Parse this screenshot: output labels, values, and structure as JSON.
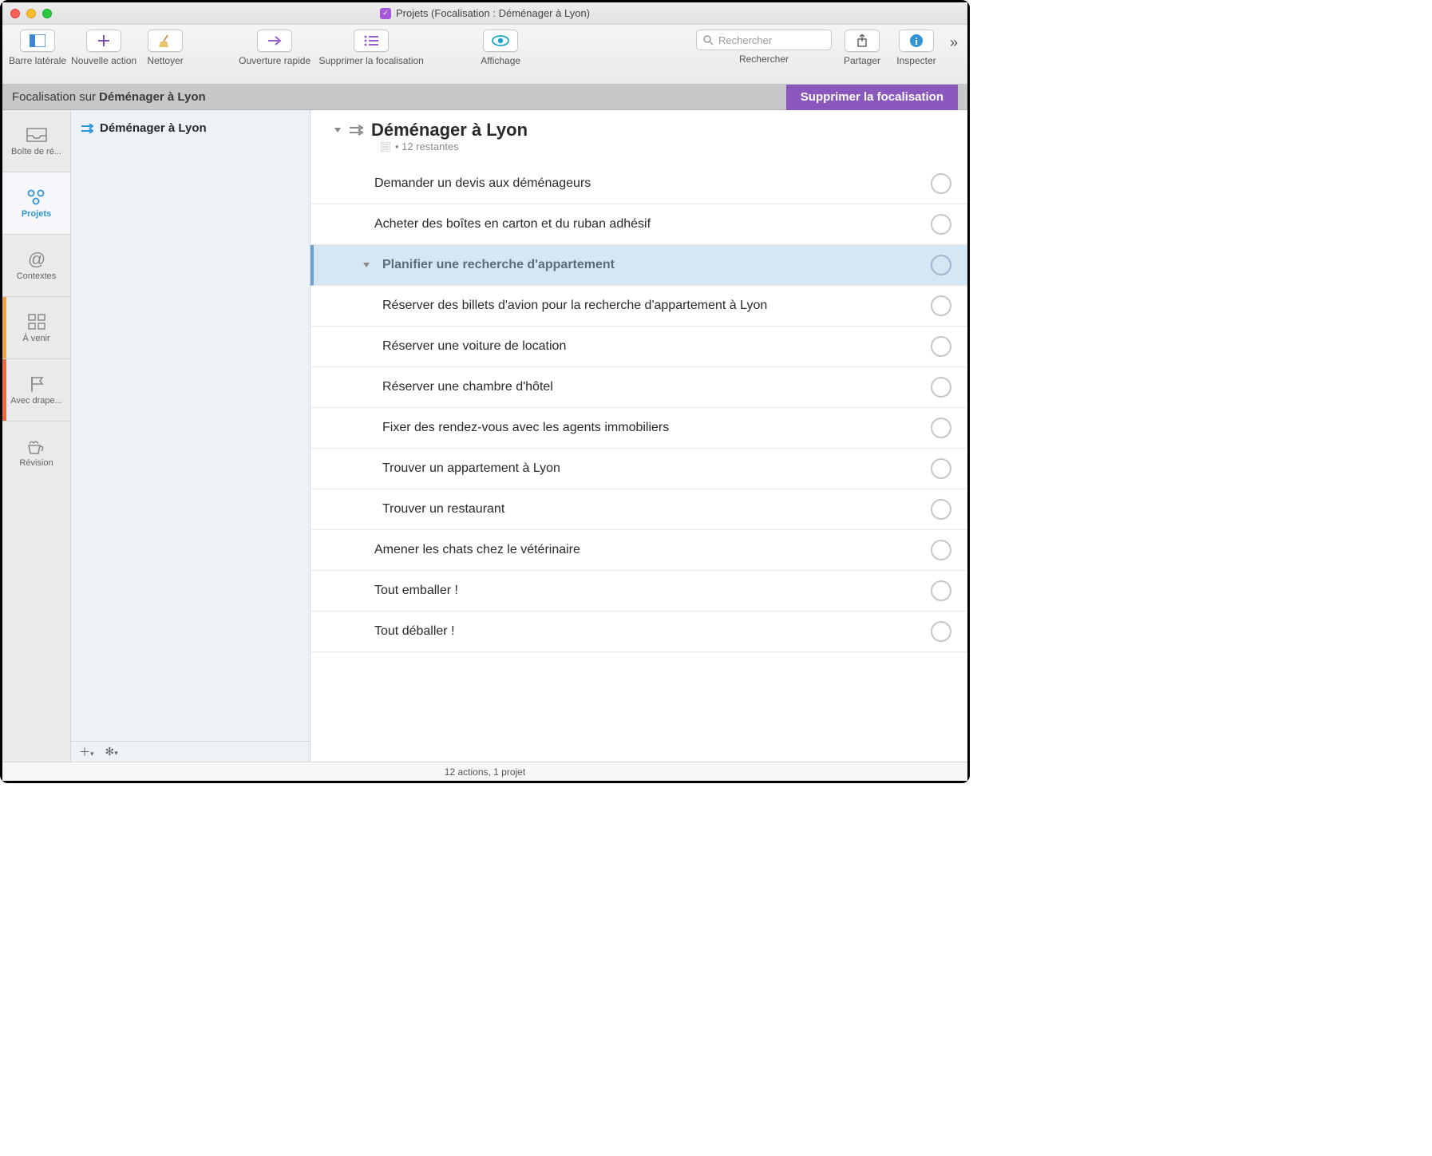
{
  "window": {
    "title": "Projets (Focalisation : Déménager à Lyon)"
  },
  "toolbar": {
    "sidebar": "Barre latérale",
    "new_action": "Nouvelle action",
    "cleanup": "Nettoyer",
    "quick_open": "Ouverture rapide",
    "remove_focus": "Supprimer la focalisation",
    "view": "Affichage",
    "search_placeholder": "Rechercher",
    "search_label": "Rechercher",
    "share": "Partager",
    "inspect": "Inspecter"
  },
  "focus": {
    "prefix": "Focalisation sur ",
    "project": "Déménager à Lyon",
    "remove": "Supprimer la focalisation"
  },
  "perspectives": [
    {
      "key": "inbox",
      "label": "Boîte de ré..."
    },
    {
      "key": "projects",
      "label": "Projets"
    },
    {
      "key": "contexts",
      "label": "Contextes"
    },
    {
      "key": "forecast",
      "label": "À venir"
    },
    {
      "key": "flagged",
      "label": "Avec drape..."
    },
    {
      "key": "review",
      "label": "Révision"
    }
  ],
  "project_list": {
    "items": [
      {
        "name": "Déménager à Lyon"
      }
    ]
  },
  "content": {
    "title": "Déménager à Lyon",
    "remaining": "12 restantes",
    "tasks": [
      {
        "title": "Demander un devis aux déménageurs",
        "indent": 0,
        "group": false
      },
      {
        "title": "Acheter des boîtes en carton et du ruban adhésif",
        "indent": 0,
        "group": false
      },
      {
        "title": "Planifier une recherche d'appartement",
        "indent": 0,
        "group": true,
        "selected": true
      },
      {
        "title": "Réserver des billets d'avion pour la recherche d'appartement à Lyon",
        "indent": 1,
        "group": false
      },
      {
        "title": "Réserver une voiture de location",
        "indent": 1,
        "group": false
      },
      {
        "title": "Réserver une chambre d'hôtel",
        "indent": 1,
        "group": false
      },
      {
        "title": "Fixer des rendez-vous avec les agents immobiliers",
        "indent": 1,
        "group": false
      },
      {
        "title": "Trouver un appartement à Lyon",
        "indent": 1,
        "group": false
      },
      {
        "title": "Trouver un restaurant",
        "indent": 1,
        "group": false
      },
      {
        "title": "Amener les chats chez le vétérinaire",
        "indent": 0,
        "group": false
      },
      {
        "title": "Tout emballer !",
        "indent": 0,
        "group": false
      },
      {
        "title": "Tout déballer !",
        "indent": 0,
        "group": false
      }
    ]
  },
  "status": {
    "text": "12 actions, 1 projet"
  }
}
